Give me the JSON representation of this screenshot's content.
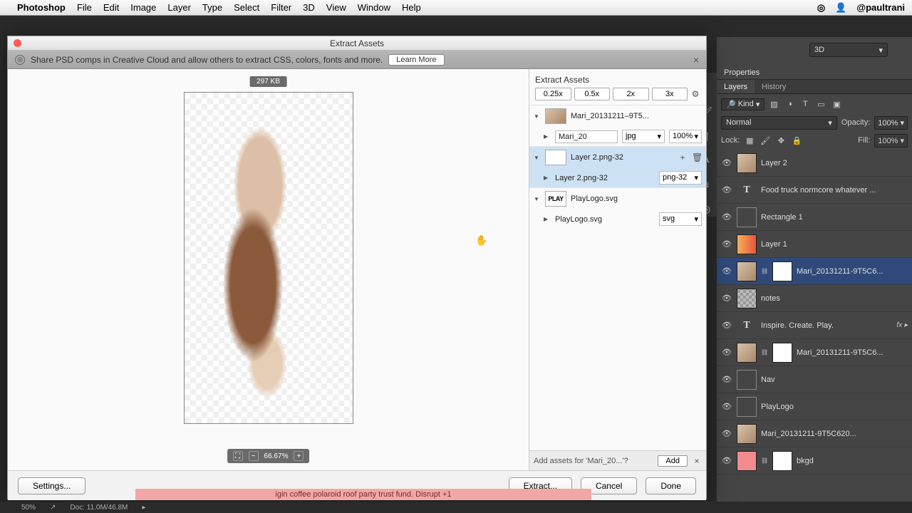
{
  "menu": {
    "brand": "Photoshop",
    "items": [
      "File",
      "Edit",
      "Image",
      "Layer",
      "Type",
      "Select",
      "Filter",
      "3D",
      "View",
      "Window",
      "Help"
    ],
    "handle": "@paultrani"
  },
  "options": {
    "dropdown": "3D"
  },
  "panels": {
    "properties": "Properties",
    "tabs": {
      "layers": "Layers",
      "history": "History"
    },
    "filter": {
      "kind": "Kind"
    },
    "blend": {
      "mode": "Normal",
      "opacity_label": "Opacity:",
      "opacity": "100%"
    },
    "lock": {
      "label": "Lock:",
      "fill_label": "Fill:",
      "fill": "100%"
    }
  },
  "layers": [
    {
      "name": "Layer 2",
      "type": "img",
      "sel": false,
      "mask": false
    },
    {
      "name": "Food truck normcore whatever ...",
      "type": "text",
      "sel": false,
      "mask": false
    },
    {
      "name": "Rectangle 1",
      "type": "rect",
      "sel": false,
      "mask": false
    },
    {
      "name": "Layer 1",
      "type": "orange",
      "sel": false,
      "mask": false
    },
    {
      "name": "Mari_20131211-9T5C6...",
      "type": "img",
      "sel": true,
      "mask": true
    },
    {
      "name": "notes",
      "type": "notes",
      "sel": false,
      "mask": false
    },
    {
      "name": "Inspire. Create. Play.",
      "type": "text",
      "sel": false,
      "mask": false,
      "fx": true
    },
    {
      "name": "Mari_20131211-9T5C6...",
      "type": "img",
      "sel": false,
      "mask": true
    },
    {
      "name": "Nav",
      "type": "rect",
      "sel": false,
      "mask": false
    },
    {
      "name": "PlayLogo",
      "type": "rect",
      "sel": false,
      "mask": false
    },
    {
      "name": "Mari_20131211-9T5C620...",
      "type": "img",
      "sel": false,
      "mask": false
    },
    {
      "name": "bkgd",
      "type": "pink",
      "sel": false,
      "mask": true
    }
  ],
  "dialog": {
    "title": "Extract Assets",
    "banner": "Share PSD comps in Creative Cloud and allow others to extract CSS, colors, fonts and more.",
    "learn": "Learn More",
    "size_badge": "297 KB",
    "zoom": "66.67%",
    "assets_title": "Extract Assets",
    "scales": [
      "0.25x",
      "0.5x",
      "2x",
      "3x"
    ],
    "assets": [
      {
        "name": "Mari_20131211–9T5...",
        "thumb": "img",
        "sub": {
          "name": "Mari_20",
          "fmt": "jpg",
          "qty": "100%"
        }
      },
      {
        "name": "Layer 2.png-32",
        "thumb": "layer2",
        "sel": true,
        "sub": {
          "name": "Layer 2.png-32",
          "fmt": "png-32"
        }
      },
      {
        "name": "PlayLogo.svg",
        "thumb": "play",
        "sub": {
          "name": "PlayLogo.svg",
          "fmt": "svg"
        }
      }
    ],
    "add_prompt": "Add assets for 'Mari_20...'?",
    "add_btn": "Add",
    "btn_settings": "Settings...",
    "btn_extract": "Extract...",
    "btn_cancel": "Cancel",
    "btn_done": "Done"
  },
  "status": {
    "zoom": "50%",
    "doc": "Doc: 11.0M/46.8M"
  },
  "banner_text": "igin coffee polaroid roof party trust fund. Disrupt +1"
}
